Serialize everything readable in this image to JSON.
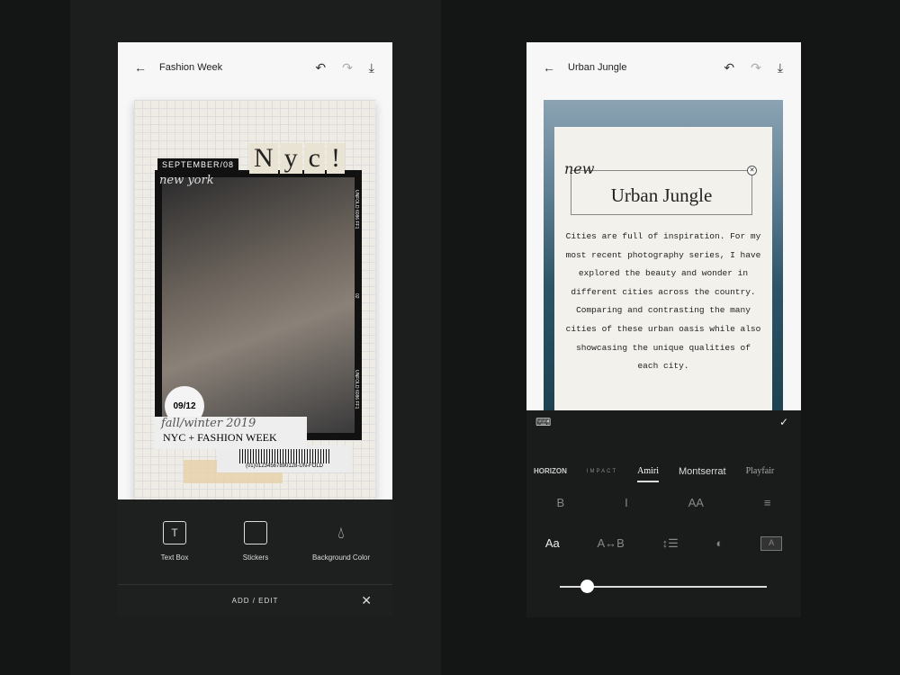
{
  "left": {
    "title": "Fashion Week",
    "poster": {
      "month": "SEPTEMBER/08",
      "script": "new york",
      "nyc": [
        "N",
        "y",
        "c",
        "!"
      ],
      "date": "09/12",
      "label": "NYC + FASHION WEEK",
      "season": "fall/winter 2019",
      "barcode": "(01)01234567890128-UN-FOLD",
      "side_top": "UNFOLD 6086 FF1",
      "side_mid": "02",
      "side_bot": "UNFOLD 6086 FF1"
    },
    "tools": [
      {
        "label": "Text Box",
        "icon": "text-box-icon"
      },
      {
        "label": "Stickers",
        "icon": "sticker-icon"
      },
      {
        "label": "Background Color",
        "icon": "drop-icon"
      }
    ],
    "footer": "ADD / EDIT"
  },
  "right": {
    "title": "Urban Jungle",
    "new": "new",
    "heading": "Urban Jungle",
    "body": "Cities are full of inspiration. For my most recent photography series, I have explored the beauty and wonder in different cities across the country. Comparing and contrasting the many cities of these urban oasis while also showcasing the unique qualities of each city.",
    "fonts": [
      "HORIZON",
      "IMPACT",
      "Amiri",
      "Montserrat",
      "Playfair"
    ],
    "selected_font": "Amiri",
    "format": [
      "B",
      "I",
      "AA",
      "≡"
    ],
    "tools2": [
      "Aa",
      "A↔B",
      "↕☰",
      "◐",
      "A"
    ],
    "size_slider": 0.13
  }
}
